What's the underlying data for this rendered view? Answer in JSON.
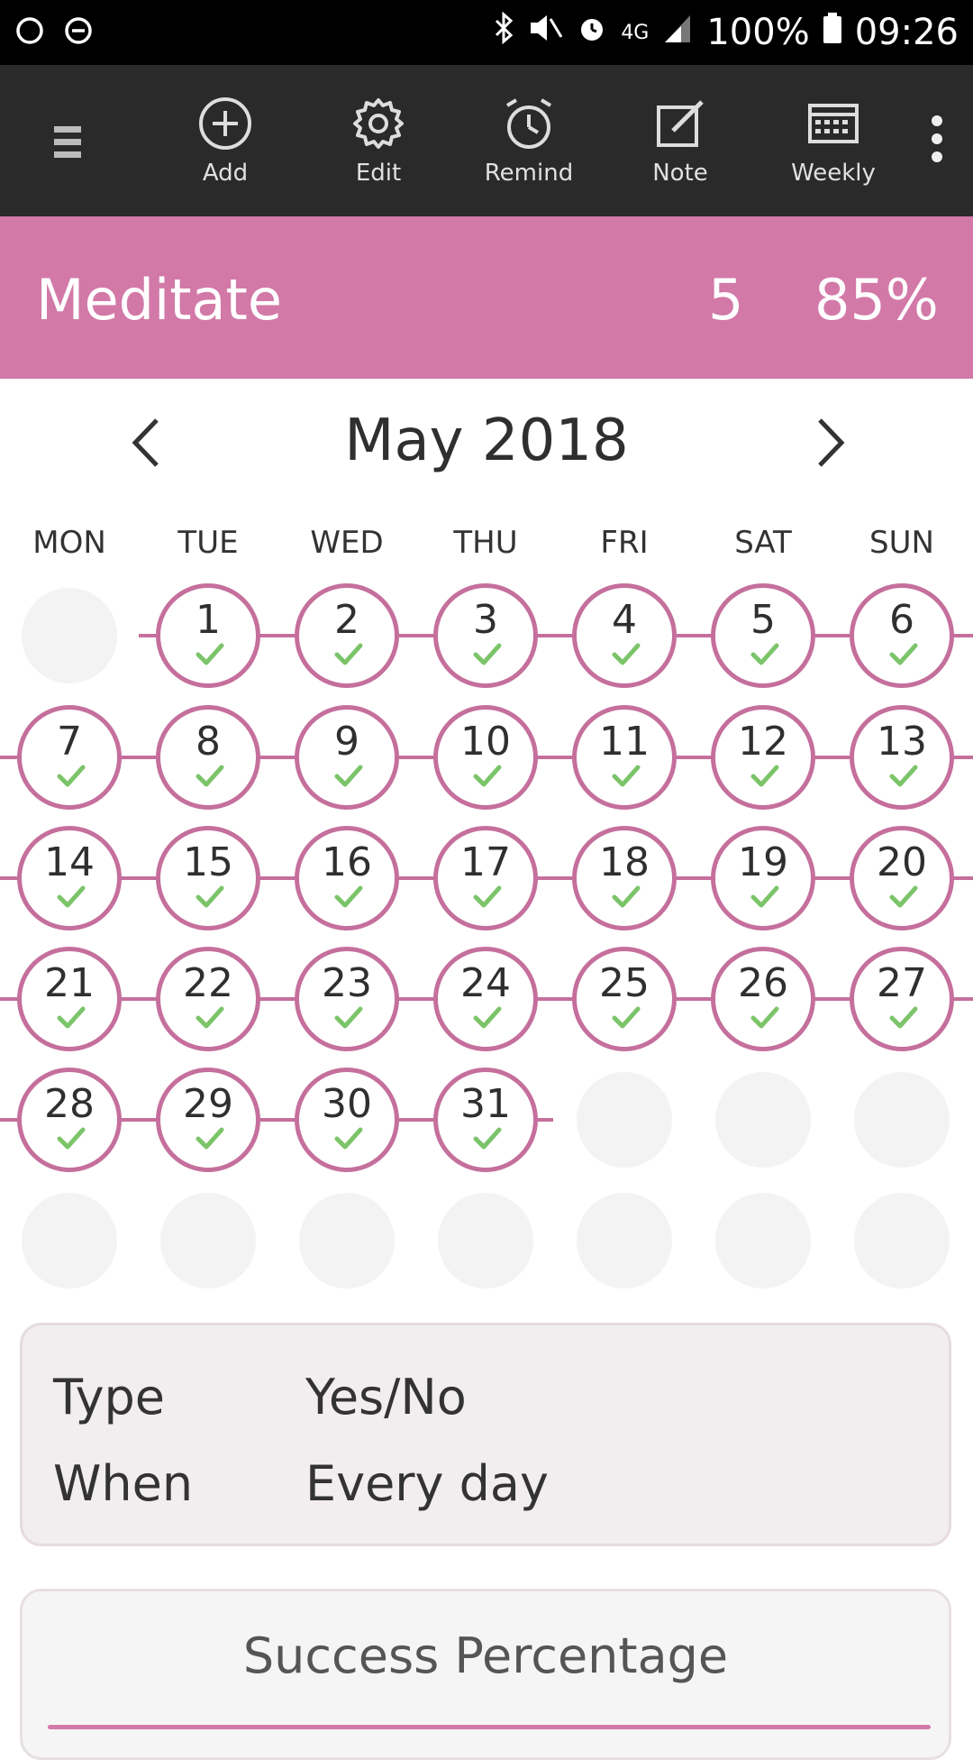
{
  "status_bar": {
    "battery": "100%",
    "time": "09:26",
    "network": "4G"
  },
  "toolbar": {
    "menu_icon": "hamburger-icon",
    "add_label": "Add",
    "edit_label": "Edit",
    "remind_label": "Remind",
    "note_label": "Note",
    "weekly_label": "Weekly",
    "more_icon": "more-vertical-icon"
  },
  "habit": {
    "name": "Meditate",
    "streak": "5",
    "percentage": "85%",
    "color": "#d279a8"
  },
  "calendar": {
    "month_title": "May 2018",
    "weekdays": [
      "MON",
      "TUE",
      "WED",
      "THU",
      "FRI",
      "SAT",
      "SUN"
    ],
    "days": [
      "1",
      "2",
      "3",
      "4",
      "5",
      "6",
      "7",
      "8",
      "9",
      "10",
      "11",
      "12",
      "13",
      "14",
      "15",
      "16",
      "17",
      "18",
      "19",
      "20",
      "21",
      "22",
      "23",
      "24",
      "25",
      "26",
      "27",
      "28",
      "29",
      "30",
      "31"
    ],
    "completed": true,
    "check_color": "#7cc46a"
  },
  "info": {
    "type_label": "Type",
    "type_value": "Yes/No",
    "when_label": "When",
    "when_value": "Every day"
  },
  "success": {
    "title": "Success Percentage"
  }
}
